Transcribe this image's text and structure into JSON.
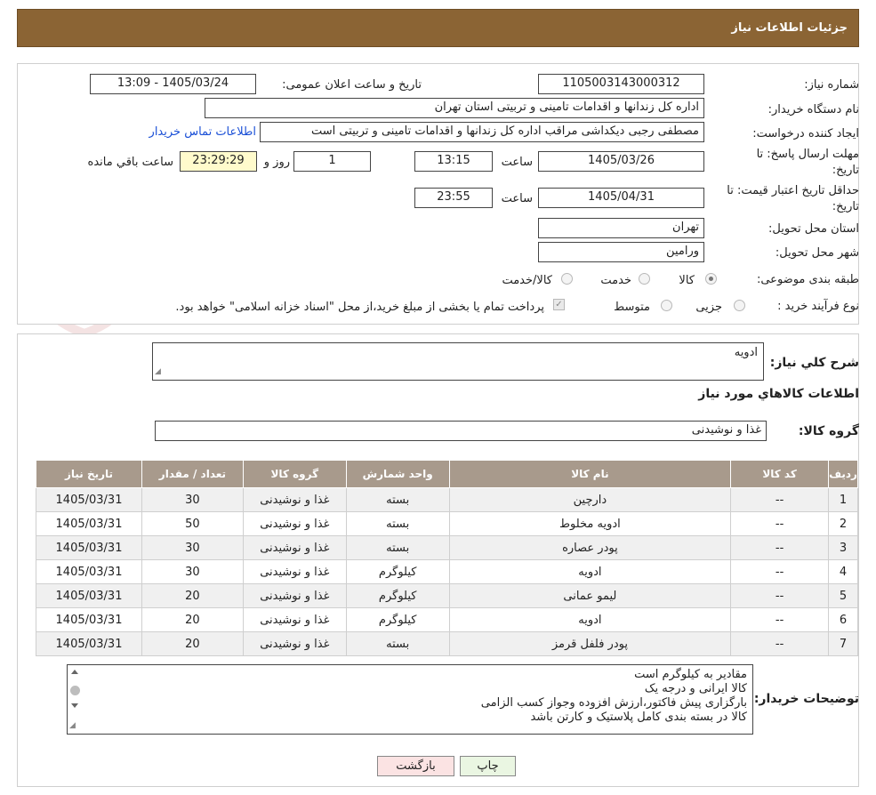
{
  "header": {
    "title": "جزئیات اطلاعات نیاز"
  },
  "form": {
    "need_number_label": "شماره نیاز:",
    "need_number": "1105003143000312",
    "announce_label": "تاریخ و ساعت اعلان عمومی:",
    "announce_value": "1405/03/24 - 13:09",
    "buyer_org_label": "نام دستگاه خریدار:",
    "buyer_org": "اداره کل زندانها و اقدامات تامینی و تربیتی استان تهران",
    "creator_label": "ایجاد کننده درخواست:",
    "creator": "مصطفی رجبی دیکداشی مراقب  اداره کل زندانها و اقدامات تامینی و تربیتی است",
    "contact_link": "اطلاعات تماس خریدار",
    "deadline_label_1": "مهلت ارسال پاسخ: تا",
    "deadline_label_2": "تاریخ:",
    "deadline_date": "1405/03/26",
    "time_label": "ساعت",
    "deadline_time": "13:15",
    "days_value": "1",
    "days_label": "روز و",
    "remaining_time": "23:29:29",
    "remaining_label": "ساعت باقي مانده",
    "validity_label_1": "حداقل تاریخ اعتبار قیمت: تا",
    "validity_label_2": "تاریخ:",
    "validity_date": "1405/04/31",
    "validity_time": "23:55",
    "province_label": "استان محل تحویل:",
    "province": "تهران",
    "city_label": "شهر محل تحویل:",
    "city": "ورامین",
    "category_label": "طبقه بندی موضوعی:",
    "category_options": [
      "کالا",
      "خدمت",
      "کالا/خدمت"
    ],
    "process_label": "نوع فرآیند خرید :",
    "process_options": [
      "جزیی",
      "متوسط"
    ],
    "payment_note": "پرداخت تمام یا بخشی از مبلغ خرید،از محل \"اسناد خزانه اسلامی\" خواهد بود."
  },
  "details": {
    "summary_label": "شرح كلي نياز:",
    "summary": "ادویه",
    "items_title": "اطلاعات كالاهاي مورد نياز",
    "group_label": "گروه کالا:",
    "group_value": "غذا و نوشیدنی",
    "columns": [
      "رديف",
      "کد کالا",
      "نام کالا",
      "واحد شمارش",
      "گروه کالا",
      "تعداد / مقدار",
      "تاریخ نیاز"
    ],
    "rows": [
      [
        "1",
        "--",
        "دارچین",
        "بسته",
        "غذا و نوشیدنی",
        "30",
        "1405/03/31"
      ],
      [
        "2",
        "--",
        "ادویه مخلوط",
        "بسته",
        "غذا و نوشیدنی",
        "50",
        "1405/03/31"
      ],
      [
        "3",
        "--",
        "پودر عصاره",
        "بسته",
        "غذا و نوشیدنی",
        "30",
        "1405/03/31"
      ],
      [
        "4",
        "--",
        "ادویه",
        "کیلوگرم",
        "غذا و نوشیدنی",
        "30",
        "1405/03/31"
      ],
      [
        "5",
        "--",
        "لیمو عمانی",
        "کیلوگرم",
        "غذا و نوشیدنی",
        "20",
        "1405/03/31"
      ],
      [
        "6",
        "--",
        "ادویه",
        "کیلوگرم",
        "غذا و نوشیدنی",
        "20",
        "1405/03/31"
      ],
      [
        "7",
        "--",
        "پودر فلفل قرمز",
        "بسته",
        "غذا و نوشیدنی",
        "20",
        "1405/03/31"
      ]
    ],
    "notes_label": "توضیحات خریدار:",
    "notes": [
      "مقادیر به کیلوگرم است",
      "کالا ایرانی و درجه یک",
      "بارگزاری پیش فاکتور،ارزش افزوده وجواز کسب الزامی",
      "کالا در بسته بندی کامل پلاستیک و کارتن باشد"
    ]
  },
  "buttons": {
    "print": "چاپ",
    "back": "بازگشت"
  },
  "watermark": {
    "text": "AriaTender.neT"
  },
  "colors": {
    "header": "#8b6434",
    "table_header": "#a89a8c",
    "back_button": "#fbe3e3",
    "print_button": "#eaf6e2",
    "link": "#1a4fd6"
  }
}
